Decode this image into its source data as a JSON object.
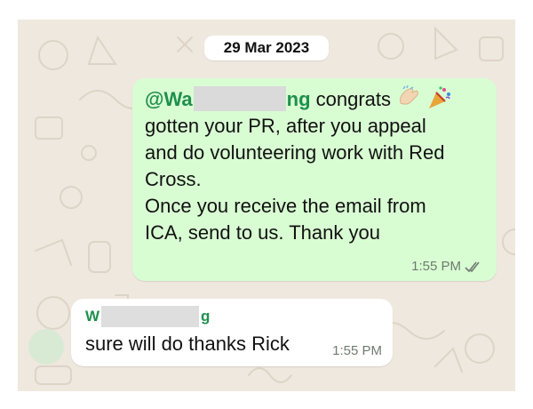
{
  "date_label": "29 Mar 2023",
  "outgoing": {
    "mention_start": "@Wa",
    "mention_end": "ng",
    "line1_rest": " congrats",
    "line2": "gotten your PR, after you appeal",
    "line3": "and do volunteering work with Red",
    "line4": "Cross.",
    "line5": "Once you receive the email from",
    "line6": "ICA, send to us. Thank you",
    "time": "1:55 PM",
    "status_icon": "double-check-icon"
  },
  "incoming": {
    "sender_start": "W",
    "sender_end": "g",
    "text": "sure will do thanks Rick",
    "time": "1:55 PM"
  },
  "colors": {
    "outgoing_bubble": "#d9fdd3",
    "chat_background": "#efe8de",
    "mention": "#1f8f4e"
  }
}
